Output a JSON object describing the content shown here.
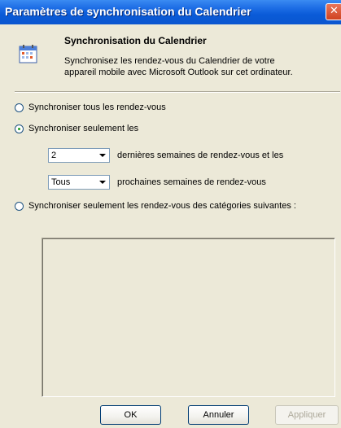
{
  "window": {
    "title": "Paramètres de synchronisation du Calendrier",
    "close_glyph": "✕"
  },
  "header": {
    "icon": "calendar-icon",
    "title": "Synchronisation du Calendrier",
    "description": "Synchronisez les rendez-vous du Calendrier de votre appareil mobile avec Microsoft Outlook sur cet ordinateur."
  },
  "options": {
    "sync_all": {
      "label": "Synchroniser tous les rendez-vous",
      "checked": false
    },
    "sync_only": {
      "label": "Synchroniser seulement les",
      "checked": true
    },
    "sync_categories": {
      "label": "Synchroniser seulement les rendez-vous des catégories suivantes :",
      "checked": false
    }
  },
  "past": {
    "value": "2",
    "suffix": "dernières semaines de rendez-vous et les"
  },
  "future": {
    "value": "Tous",
    "suffix": "prochaines semaines de rendez-vous"
  },
  "categories": [],
  "buttons": {
    "ok": "OK",
    "cancel": "Annuler",
    "apply": "Appliquer"
  },
  "colors": {
    "titlebar": "#0A5BD8",
    "face": "#ECE9D8",
    "close": "#D0421F"
  }
}
